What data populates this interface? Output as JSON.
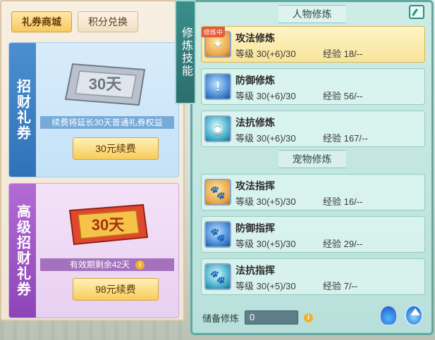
{
  "tabs": [
    {
      "label": "礼券商城"
    },
    {
      "label": "积分兑换"
    }
  ],
  "left_cards": [
    {
      "side_label": "招财礼券",
      "ticket_text": "30天",
      "promo_text": "续费将延长30天普通礼券权益",
      "button_label": "30元续费"
    },
    {
      "side_label": "高级招财礼券",
      "ticket_text": "30天",
      "promo_text": "有效期剩余42天",
      "button_label": "98元续费"
    }
  ],
  "skill_tab_label": "修炼技能",
  "character_section": {
    "title": "人物修炼",
    "rows": [
      {
        "name": "攻法修炼",
        "tag": "修炼中",
        "level": "等级  30(+6)/30",
        "exp": "经验  18/--",
        "icon": "attack-icon"
      },
      {
        "name": "防御修炼",
        "level": "等级  30(+6)/30",
        "exp": "经验  56/--",
        "icon": "defense-icon"
      },
      {
        "name": "法抗修炼",
        "level": "等级  30(+6)/30",
        "exp": "经验  167/--",
        "icon": "magic-resist-icon"
      }
    ]
  },
  "pet_section": {
    "title": "宠物修炼",
    "rows": [
      {
        "name": "攻法指挥",
        "level": "等级  30(+5)/30",
        "exp": "经验  16/--",
        "icon": "pet-attack-icon"
      },
      {
        "name": "防御指挥",
        "level": "等级  30(+5)/30",
        "exp": "经验  29/--",
        "icon": "pet-defense-icon"
      },
      {
        "name": "法抗指挥",
        "level": "等级  30(+5)/30",
        "exp": "经验  7/--",
        "icon": "pet-magic-resist-icon"
      }
    ]
  },
  "reserve": {
    "label": "储备修炼",
    "value": "0"
  }
}
